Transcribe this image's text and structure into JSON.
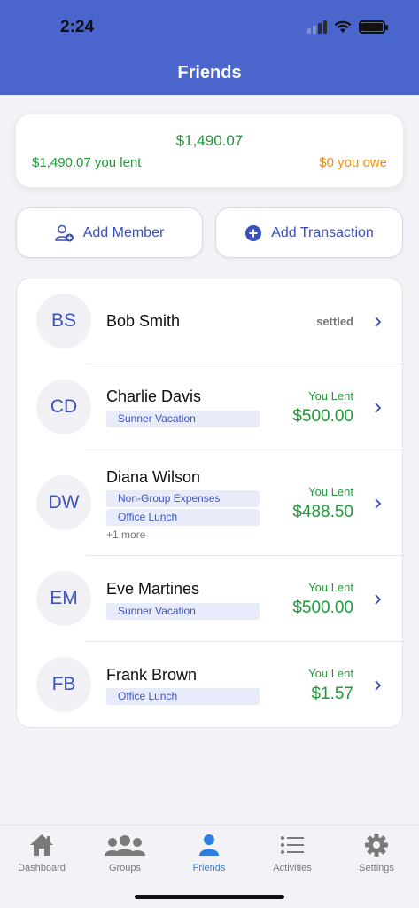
{
  "status_bar": {
    "time": "2:24"
  },
  "header": {
    "title": "Friends"
  },
  "summary": {
    "total": "$1,490.07",
    "lent": "$1,490.07 you lent",
    "owe": "$0 you owe"
  },
  "actions": {
    "add_member": "Add Member",
    "add_transaction": "Add Transaction"
  },
  "friends": [
    {
      "initials": "BS",
      "name": "Bob Smith",
      "status": "settled",
      "tags": [],
      "more": "",
      "amount": ""
    },
    {
      "initials": "CD",
      "name": "Charlie Davis",
      "status": "You Lent",
      "tags": [
        "Sunner Vacation"
      ],
      "more": "",
      "amount": "$500.00"
    },
    {
      "initials": "DW",
      "name": "Diana Wilson",
      "status": "You Lent",
      "tags": [
        "Non-Group Expenses",
        "Office Lunch"
      ],
      "more": "+1 more",
      "amount": "$488.50"
    },
    {
      "initials": "EM",
      "name": "Eve Martines",
      "status": "You Lent",
      "tags": [
        "Sunner Vacation"
      ],
      "more": "",
      "amount": "$500.00"
    },
    {
      "initials": "FB",
      "name": "Frank Brown",
      "status": "You Lent",
      "tags": [
        "Office Lunch"
      ],
      "more": "",
      "amount": "$1.57"
    }
  ],
  "tabs": [
    {
      "label": "Dashboard",
      "icon": "house-icon",
      "active": false
    },
    {
      "label": "Groups",
      "icon": "people-icon",
      "active": false
    },
    {
      "label": "Friends",
      "icon": "person-icon",
      "active": true
    },
    {
      "label": "Activities",
      "icon": "list-icon",
      "active": false
    },
    {
      "label": "Settings",
      "icon": "gear-icon",
      "active": false
    }
  ],
  "colors": {
    "header": "#4a66cc",
    "accent": "#3a4fb8",
    "positive": "#1f9a38",
    "owe": "#f0900c",
    "active_tab": "#2f7de0"
  }
}
